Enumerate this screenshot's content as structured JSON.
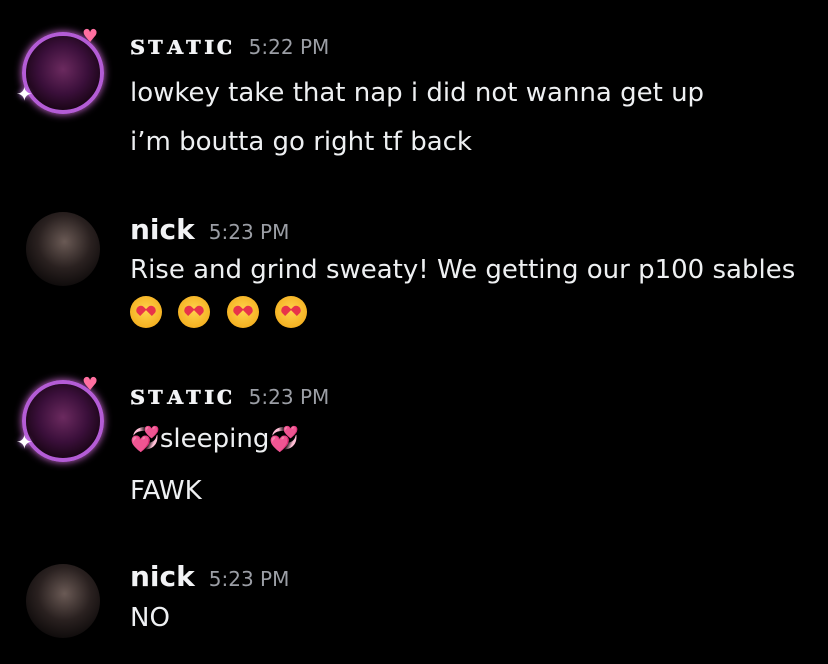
{
  "messages": [
    {
      "author": "ꜱᴛᴀᴛɪᴄ",
      "time": "5:22 PM",
      "lines": [
        "lowkey take that nap i did not wanna get up",
        "i’m boutta go right tf back"
      ]
    },
    {
      "author": "nick",
      "time": "5:23 PM",
      "lines": [
        "Rise and grind sweaty! We getting our p100 sables"
      ],
      "emojis": [
        "heart-eyes-cat-emoji",
        "heart-eyes-cat-emoji",
        "heart-eyes-cat-emoji",
        "heart-eyes-cat-emoji"
      ]
    },
    {
      "author": "ꜱᴛᴀᴛɪᴄ",
      "time": "5:23 PM",
      "lines": [
        "sleeping",
        "FAWK"
      ],
      "inline_icons": [
        "revolving-hearts-emoji",
        "revolving-hearts-emoji"
      ]
    },
    {
      "author": "nick",
      "time": "5:23 PM",
      "lines": [
        "NO"
      ]
    }
  ],
  "colors": {
    "background": "#000000",
    "text": "#eef0f2",
    "timestamp": "#9b9ea5",
    "decor_ring": "#b45cd6"
  }
}
